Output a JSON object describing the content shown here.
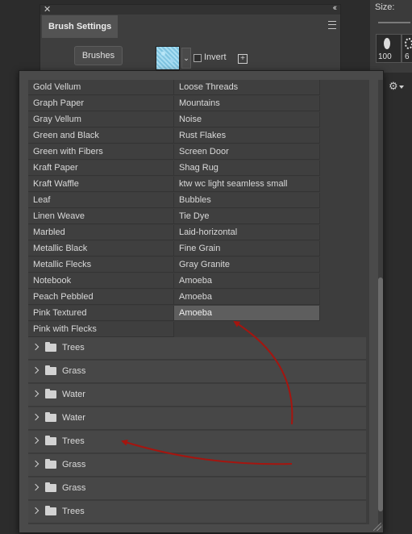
{
  "brush_settings_panel": {
    "tab_label": "Brush Settings",
    "brushes_button": "Brushes",
    "invert_label": "Invert"
  },
  "brushes_panel": {
    "size_label": "Size:",
    "tips": [
      "100",
      "6"
    ]
  },
  "presets": {
    "col1": [
      "Gold Vellum",
      "Graph Paper",
      "Gray Vellum",
      "Green and Black",
      "Green with Fibers",
      "Kraft Paper",
      "Kraft Waffle",
      "Leaf",
      "Linen Weave",
      "Marbled",
      "Metallic Black",
      "Metallic Flecks",
      "Notebook",
      "Peach Pebbled",
      "Pink Textured",
      "Pink with Flecks"
    ],
    "col2": [
      "Loose Threads",
      "Mountains",
      "Noise",
      "Rust Flakes",
      "Screen Door",
      "Shag Rug",
      "ktw wc light seamless small",
      "Bubbles",
      "Tie Dye",
      "Laid-horizontal",
      "Fine Grain",
      "Gray Granite",
      "Amoeba",
      "Amoeba",
      "Amoeba",
      ""
    ],
    "selected": "Amoeba"
  },
  "groups": [
    "Trees",
    "Grass",
    "Water",
    "Water",
    "Trees",
    "Grass",
    "Grass",
    "Trees"
  ],
  "icons": {
    "close": "close-icon",
    "collapse": "double-chevron-icon",
    "panel_menu": "hamburger-menu-icon",
    "new_brush": "plus-icon",
    "settings": "gear-icon",
    "group_expand": "chevron-right-icon",
    "group_folder": "folder-icon"
  },
  "colors": {
    "annotation_arrow": "#a5150f",
    "selected_row": "#5e5e5e"
  }
}
